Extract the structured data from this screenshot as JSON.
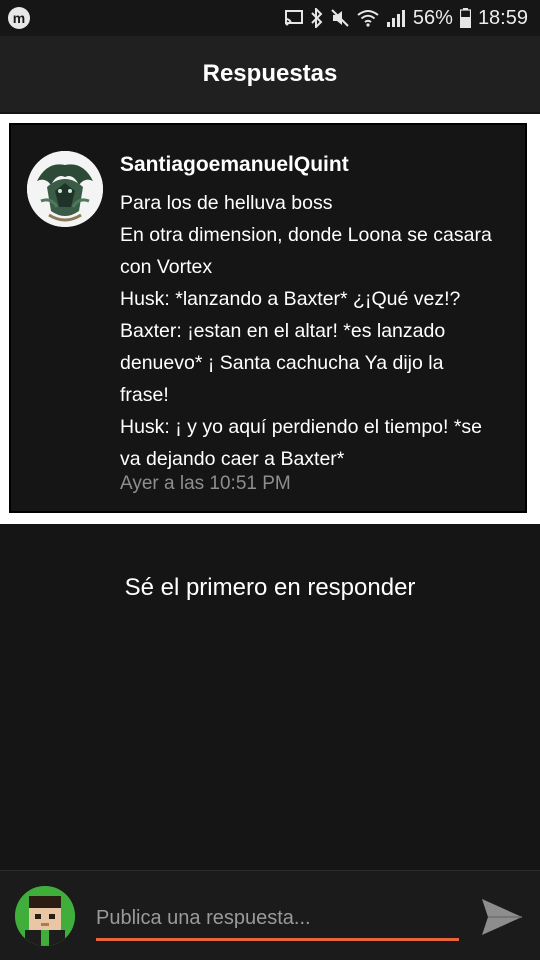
{
  "status_bar": {
    "app_icon": "m-app-icon",
    "icons": [
      "cast-icon",
      "bluetooth-icon",
      "mute-icon",
      "wifi-icon",
      "signal-icon"
    ],
    "battery": "56%",
    "time": "18:59"
  },
  "header": {
    "title": "Respuestas"
  },
  "post": {
    "author": "SantiagoemanuelQuint",
    "lines": [
      "Para los de helluva boss",
      "En otra dimension, donde Loona se casara",
      "con Vortex",
      "Husk: *lanzando a Baxter* ¿¡Qué vez!?",
      "Baxter: ¡estan en el altar! *es lanzado",
      "denuevo* ¡ Santa cachucha Ya dijo la",
      "frase!",
      "Husk: ¡ y yo aquí perdiendo el tiempo! *se",
      "va dejando caer a Baxter*"
    ],
    "timestamp": "Ayer a las 10:51 PM"
  },
  "empty_state": {
    "message": "Sé el primero en responder"
  },
  "reply": {
    "placeholder": "Publica una respuesta...",
    "accent_color": "#e8643a"
  }
}
